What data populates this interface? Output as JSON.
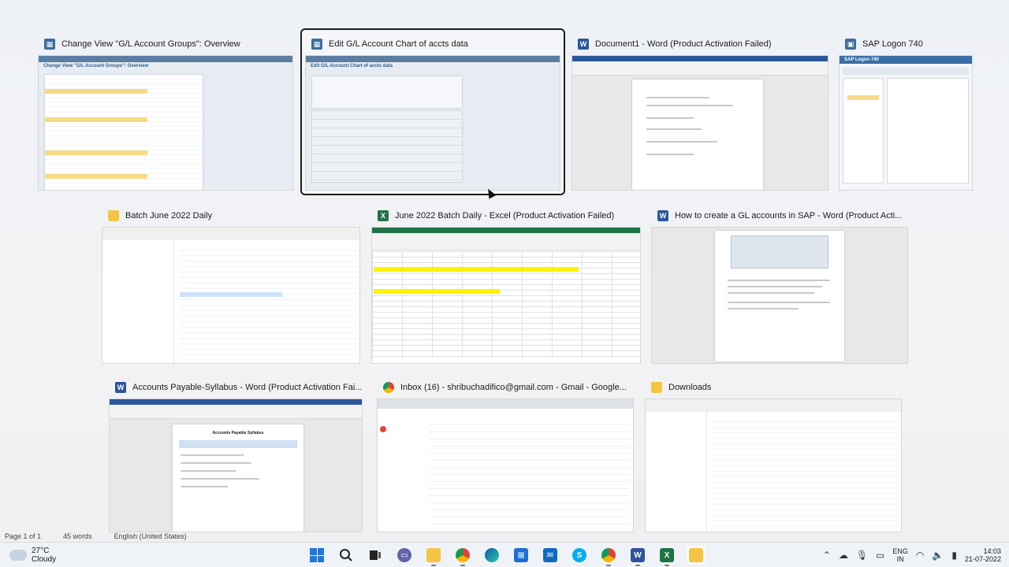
{
  "windows": [
    {
      "title": "Change View \"G/L Account Groups\": Overview",
      "app": "sap-gui",
      "thumb_caption": "Change View \"G/L Account Groups\": Overview"
    },
    {
      "title": "Edit G/L Account Chart of accts data",
      "app": "sap-gui",
      "thumb_caption": "Edit G/L Account Chart of accts data",
      "focused": true
    },
    {
      "title": "Document1 - Word (Product Activation Failed)",
      "app": "word"
    },
    {
      "title": "SAP Logon 740",
      "app": "sap-logon",
      "thumb_caption": "SAP Logon 740"
    },
    {
      "title": "Batch June 2022 Daily",
      "app": "file-explorer"
    },
    {
      "title": "June 2022 Batch Daily - Excel (Product Activation Failed)",
      "app": "excel"
    },
    {
      "title": "How to create a GL accounts in SAP - Word (Product Acti...",
      "app": "word"
    },
    {
      "title": "Accounts Payable-Syllabus - Word (Product Activation Fai...",
      "app": "word",
      "thumb_caption": "Accounts Payable Syllabus"
    },
    {
      "title": "Inbox (16) - shribuchadifico@gmail.com - Gmail - Google...",
      "app": "chrome"
    },
    {
      "title": "Downloads",
      "app": "file-explorer"
    }
  ],
  "word_status": {
    "page": "Page 1 of 1",
    "words": "45 words",
    "language": "English (United States)"
  },
  "taskbar": {
    "weather": {
      "temp": "27°C",
      "condition": "Cloudy"
    },
    "apps": [
      "windows-start",
      "search",
      "task-view",
      "teams-chat",
      "file-explorer",
      "chrome",
      "edge",
      "microsoft-store",
      "mail",
      "skype",
      "chrome-2",
      "word",
      "excel",
      "file-explorer-2"
    ],
    "tray": {
      "lang_top": "ENG",
      "lang_bottom": "IN",
      "time": "14:03",
      "date": "21-07-2022"
    }
  },
  "colors": {
    "sap": "#3c6e9c",
    "word": "#2b579a",
    "excel": "#217346",
    "folder": "#f4c542"
  }
}
